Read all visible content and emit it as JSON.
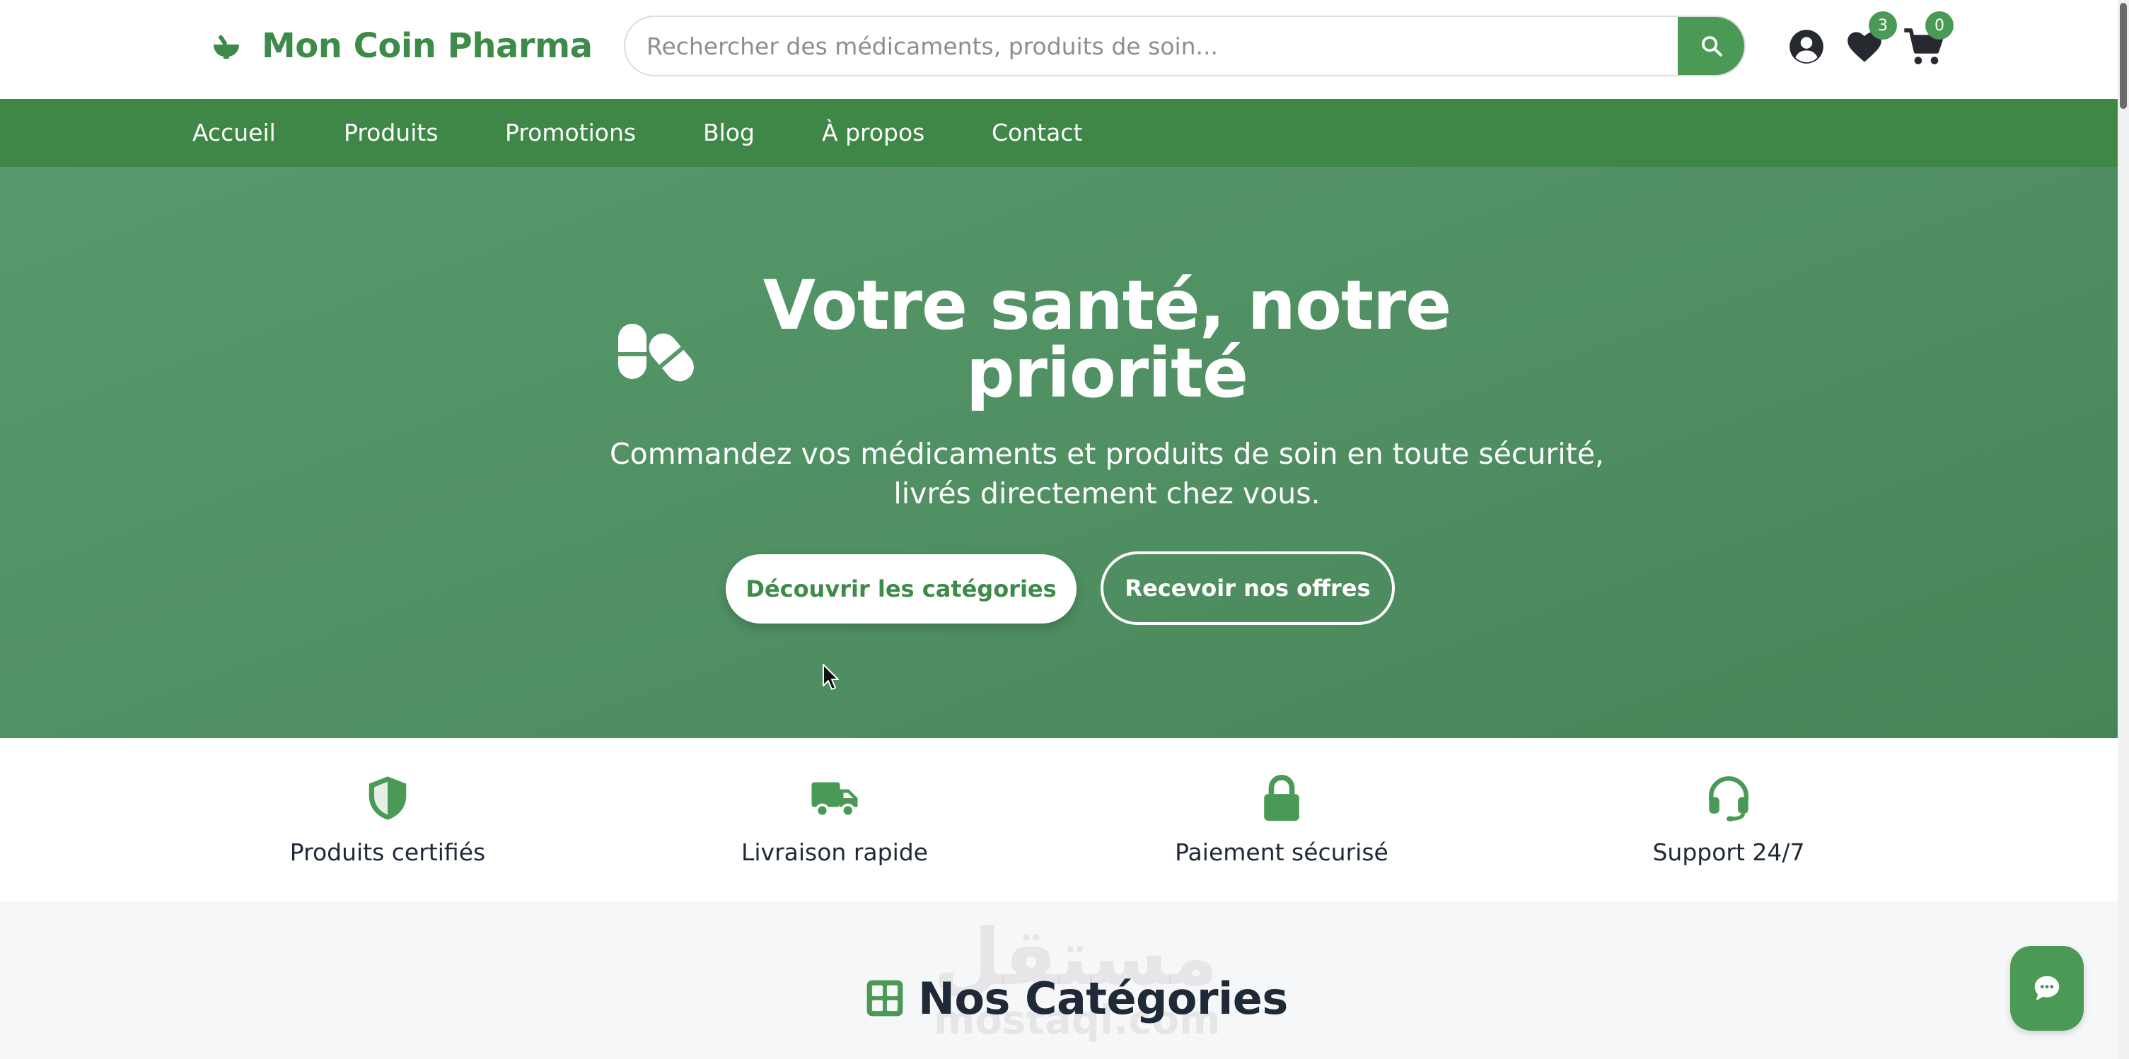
{
  "header": {
    "brand": "Mon Coin Pharma",
    "logo_icon": "mortar-pestle-icon",
    "search_placeholder": "Rechercher des médicaments, produits de soin...",
    "search_icon": "search-icon",
    "account_icon": "user-circle-icon",
    "wishlist_icon": "heart-icon",
    "wishlist_count": "3",
    "cart_icon": "shopping-cart-icon",
    "cart_count": "0"
  },
  "nav": {
    "items": [
      "Accueil",
      "Produits",
      "Promotions",
      "Blog",
      "À propos",
      "Contact"
    ]
  },
  "hero": {
    "icon": "pills-icon",
    "title": "Votre santé, notre priorité",
    "subtitle": "Commandez vos médicaments et produits de soin en toute sécurité, livrés directement chez vous.",
    "primary_button": "Découvrir les catégories",
    "secondary_button": "Recevoir nos offres"
  },
  "features": [
    {
      "icon": "shield-icon",
      "label": "Produits certifiés"
    },
    {
      "icon": "truck-icon",
      "label": "Livraison rapide"
    },
    {
      "icon": "lock-icon",
      "label": "Paiement sécurisé"
    },
    {
      "icon": "headset-icon",
      "label": "Support 24/7"
    }
  ],
  "categories": {
    "icon": "grid-icon",
    "title": "Nos Catégories"
  },
  "watermark": {
    "arabic": "مستقل",
    "latin": "mostaql.com"
  },
  "chat_icon": "chat-bubble-icon",
  "colors": {
    "brand_green": "#3e8a49",
    "nav_green": "#3f8746",
    "hero_green": "#4f8f62",
    "accent_green": "#4a9a56"
  }
}
